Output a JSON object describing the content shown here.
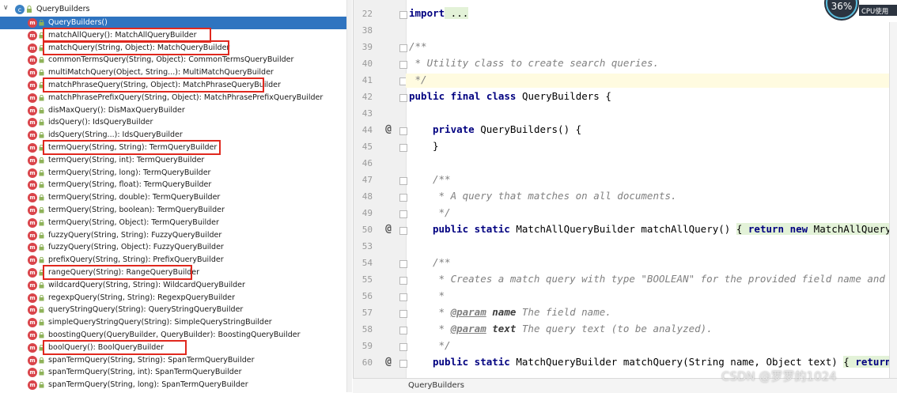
{
  "structure": {
    "root_label": "QueryBuilders",
    "items": [
      {
        "label": "QueryBuilders()",
        "selected": true,
        "highlighted": false
      },
      {
        "label": "matchAllQuery(): MatchAllQueryBuilder",
        "selected": false,
        "highlighted": true
      },
      {
        "label": "matchQuery(String, Object): MatchQueryBuilder",
        "selected": false,
        "highlighted": true
      },
      {
        "label": "commonTermsQuery(String, Object): CommonTermsQueryBuilder",
        "selected": false,
        "highlighted": false
      },
      {
        "label": "multiMatchQuery(Object, String...): MultiMatchQueryBuilder",
        "selected": false,
        "highlighted": false
      },
      {
        "label": "matchPhraseQuery(String, Object): MatchPhraseQueryBuilder",
        "selected": false,
        "highlighted": true
      },
      {
        "label": "matchPhrasePrefixQuery(String, Object): MatchPhrasePrefixQueryBuilder",
        "selected": false,
        "highlighted": false
      },
      {
        "label": "disMaxQuery(): DisMaxQueryBuilder",
        "selected": false,
        "highlighted": false
      },
      {
        "label": "idsQuery(): IdsQueryBuilder",
        "selected": false,
        "highlighted": false
      },
      {
        "label": "idsQuery(String...): IdsQueryBuilder",
        "selected": false,
        "highlighted": false
      },
      {
        "label": "termQuery(String, String): TermQueryBuilder",
        "selected": false,
        "highlighted": true
      },
      {
        "label": "termQuery(String, int): TermQueryBuilder",
        "selected": false,
        "highlighted": false
      },
      {
        "label": "termQuery(String, long): TermQueryBuilder",
        "selected": false,
        "highlighted": false
      },
      {
        "label": "termQuery(String, float): TermQueryBuilder",
        "selected": false,
        "highlighted": false
      },
      {
        "label": "termQuery(String, double): TermQueryBuilder",
        "selected": false,
        "highlighted": false
      },
      {
        "label": "termQuery(String, boolean): TermQueryBuilder",
        "selected": false,
        "highlighted": false
      },
      {
        "label": "termQuery(String, Object): TermQueryBuilder",
        "selected": false,
        "highlighted": false
      },
      {
        "label": "fuzzyQuery(String, String): FuzzyQueryBuilder",
        "selected": false,
        "highlighted": false
      },
      {
        "label": "fuzzyQuery(String, Object): FuzzyQueryBuilder",
        "selected": false,
        "highlighted": false
      },
      {
        "label": "prefixQuery(String, String): PrefixQueryBuilder",
        "selected": false,
        "highlighted": false
      },
      {
        "label": "rangeQuery(String): RangeQueryBuilder",
        "selected": false,
        "highlighted": true
      },
      {
        "label": "wildcardQuery(String, String): WildcardQueryBuilder",
        "selected": false,
        "highlighted": false
      },
      {
        "label": "regexpQuery(String, String): RegexpQueryBuilder",
        "selected": false,
        "highlighted": false
      },
      {
        "label": "queryStringQuery(String): QueryStringQueryBuilder",
        "selected": false,
        "highlighted": false
      },
      {
        "label": "simpleQueryStringQuery(String): SimpleQueryStringBuilder",
        "selected": false,
        "highlighted": false
      },
      {
        "label": "boostingQuery(QueryBuilder, QueryBuilder): BoostingQueryBuilder",
        "selected": false,
        "highlighted": false
      },
      {
        "label": "boolQuery(): BoolQueryBuilder",
        "selected": false,
        "highlighted": true
      },
      {
        "label": "spanTermQuery(String, String): SpanTermQueryBuilder",
        "selected": false,
        "highlighted": false
      },
      {
        "label": "spanTermQuery(String, int): SpanTermQueryBuilder",
        "selected": false,
        "highlighted": false
      },
      {
        "label": "spanTermQuery(String, long): SpanTermQueryBuilder",
        "selected": false,
        "highlighted": false
      }
    ]
  },
  "editor": {
    "lines": [
      {
        "no": "22",
        "kind": "import",
        "text_kw": "import",
        "text_rest": " ..."
      },
      {
        "no": "38",
        "kind": "blank"
      },
      {
        "no": "39",
        "kind": "comment",
        "text": "/**"
      },
      {
        "no": "40",
        "kind": "comment",
        "text": " * Utility class to create search queries."
      },
      {
        "no": "41",
        "kind": "comment",
        "text": " */",
        "current": true
      },
      {
        "no": "42",
        "kind": "code",
        "segments": [
          [
            "kw",
            "public final class"
          ],
          [
            "pl",
            " QueryBuilders {"
          ]
        ]
      },
      {
        "no": "43",
        "kind": "blank"
      },
      {
        "no": "44",
        "kind": "code",
        "indent": 1,
        "at": true,
        "segments": [
          [
            "kw",
            "private"
          ],
          [
            "pl",
            " QueryBuilders() {"
          ]
        ]
      },
      {
        "no": "45",
        "kind": "code",
        "indent": 1,
        "segments": [
          [
            "pl",
            "}"
          ]
        ]
      },
      {
        "no": "46",
        "kind": "blank"
      },
      {
        "no": "47",
        "kind": "comment",
        "indent": 1,
        "text": "/**"
      },
      {
        "no": "48",
        "kind": "comment",
        "indent": 1,
        "text": " * A query that matches on all documents."
      },
      {
        "no": "49",
        "kind": "comment",
        "indent": 1,
        "text": " */"
      },
      {
        "no": "50",
        "kind": "code",
        "indent": 1,
        "at": true,
        "segments": [
          [
            "kw",
            "public static"
          ],
          [
            "pl",
            " MatchAllQueryBuilder matchAllQuery() "
          ],
          [
            "hl",
            "{ "
          ],
          [
            "kwhl",
            "return new"
          ],
          [
            "hl",
            " MatchAllQueryBu"
          ]
        ]
      },
      {
        "no": "53",
        "kind": "blank"
      },
      {
        "no": "54",
        "kind": "comment",
        "indent": 1,
        "text": "/**"
      },
      {
        "no": "55",
        "kind": "comment",
        "indent": 1,
        "text": " * Creates a match query with type \"BOOLEAN\" for the provided field name and text"
      },
      {
        "no": "56",
        "kind": "comment",
        "indent": 1,
        "text": " *"
      },
      {
        "no": "57",
        "kind": "param",
        "indent": 1,
        "tag": "@param",
        "name": "name",
        "desc": " The field name."
      },
      {
        "no": "58",
        "kind": "param",
        "indent": 1,
        "tag": "@param",
        "name": "text",
        "desc": " The query text (to be analyzed)."
      },
      {
        "no": "59",
        "kind": "comment",
        "indent": 1,
        "text": " */"
      },
      {
        "no": "60",
        "kind": "code",
        "indent": 1,
        "at": true,
        "segments": [
          [
            "kw",
            "public static"
          ],
          [
            "pl",
            " MatchQueryBuilder matchQuery(String name, Object text) "
          ],
          [
            "hl",
            "{ "
          ],
          [
            "kwhl",
            "return n"
          ]
        ]
      }
    ]
  },
  "breadcrumb": "QueryBuilders",
  "cpu": {
    "percent": "36%",
    "label": "CPU使用"
  },
  "watermark": "CSDN @罗罗的1024"
}
